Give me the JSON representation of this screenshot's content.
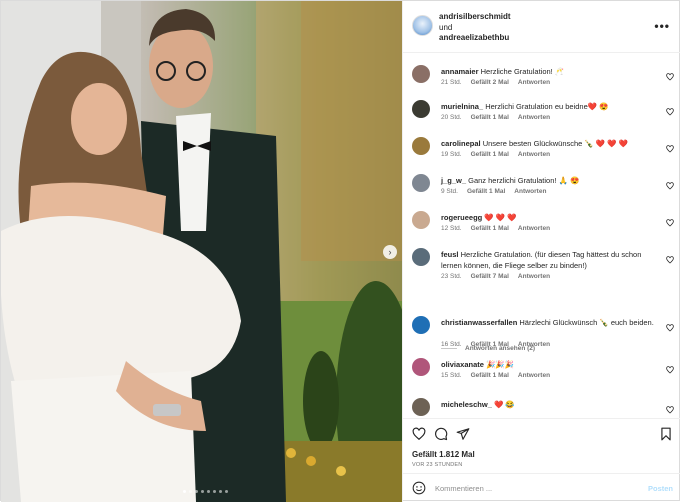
{
  "header": {
    "user1": "andrisilberschmidt",
    "and": "und",
    "user2": "andreaelizabethbu"
  },
  "comments": [
    {
      "user": "annamaier",
      "text": "Herzliche Gratulation! 🥂",
      "age": "21 Std.",
      "likes": "Gefällt 2 Mal",
      "reply": "Antworten",
      "avatar_color": "#8a6f66"
    },
    {
      "user": "murielnina_",
      "text": "Herzlichi Gratulation eu beidne❤️ 😍",
      "age": "20 Std.",
      "likes": "Gefällt 1 Mal",
      "reply": "Antworten",
      "avatar_color": "#3b3b32"
    },
    {
      "user": "carolinepal",
      "text": "Unsere besten Glückwünsche 🍾 ❤️ ❤️ ❤️",
      "age": "19 Std.",
      "likes": "Gefällt 1 Mal",
      "reply": "Antworten",
      "avatar_color": "#9a7a3c"
    },
    {
      "user": "j_g_w_",
      "text": "Ganz herzlichi Gratulation! 🙏 😍",
      "age": "9 Std.",
      "likes": "Gefällt 1 Mal",
      "reply": "Antworten",
      "avatar_color": "#7f8792"
    },
    {
      "user": "rogerueegg",
      "text": "❤️ ❤️ ❤️",
      "age": "12 Std.",
      "likes": "Gefällt 1 Mal",
      "reply": "Antworten",
      "avatar_color": "#c9a990"
    },
    {
      "user": "feusl",
      "text": "Herzliche Gratulation. (für diesen Tag hättest du schon lernen können, die Fliege selber zu binden!)",
      "age": "23 Std.",
      "likes": "Gefällt 7 Mal",
      "reply": "Antworten",
      "avatar_color": "#5a6c7a"
    },
    {
      "user": "christianwasserfallen",
      "text": "Härzlechi Glückwünsch 🍾 euch beiden.",
      "age": "16 Std.",
      "likes": "Gefällt 1 Mal",
      "reply": "Antworten",
      "avatar_color": "#1f6fb5"
    },
    {
      "user": "oliviaxanate",
      "text": "🎉🎉🎉",
      "age": "15 Std.",
      "likes": "Gefällt 1 Mal",
      "reply": "Antworten",
      "avatar_color": "#b0567a"
    },
    {
      "user": "micheleschw_",
      "text": "❤️ 😂",
      "age": "",
      "likes": "",
      "reply": "",
      "avatar_color": "#6d6255"
    }
  ],
  "view_replies": "Antworten ansehen (2)",
  "actions": {
    "likes": "Gefällt 1.812 Mal",
    "time": "VOR 23 STUNDEN"
  },
  "input": {
    "placeholder": "Kommentieren ...",
    "post_label": "Posten"
  },
  "icons": {
    "more": "more-horizontal-icon",
    "heart": "heart-icon",
    "comment": "comment-icon",
    "share": "share-icon",
    "bookmark": "bookmark-icon",
    "emoji": "emoji-icon",
    "next": "chevron-right-icon"
  },
  "colors": {
    "link_blue": "#0095f6",
    "post_disabled": "#b2dffc",
    "verified": "#3897f0"
  }
}
